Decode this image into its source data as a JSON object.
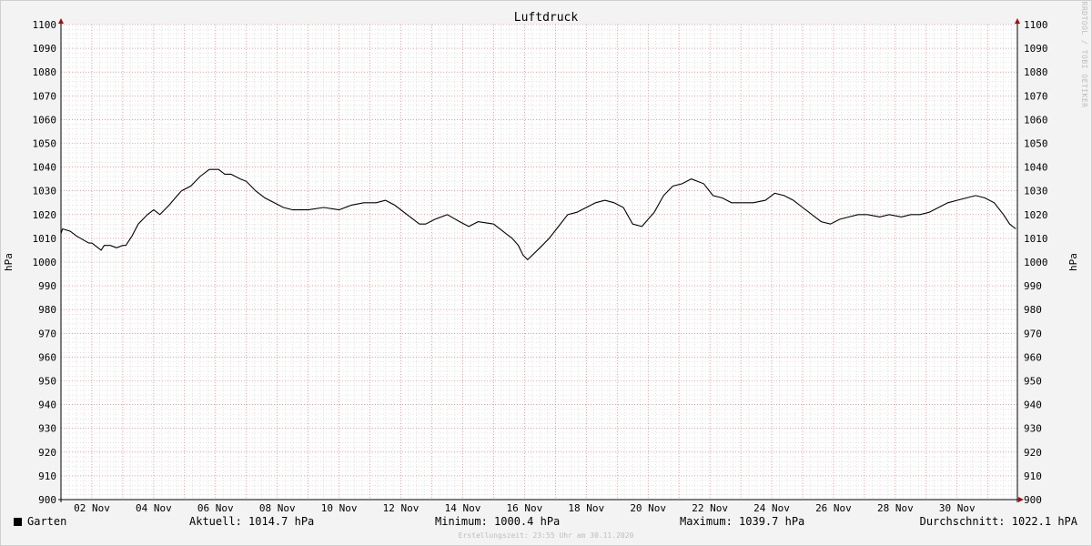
{
  "watermark": "RRDTOOL / TOBI OETIKER",
  "legend": {
    "series_name": "Garten",
    "series_color": "#000000",
    "current": "Aktuell: 1014.7 hPa",
    "minimum": "Minimum: 1000.4 hPa",
    "maximum": "Maximum: 1039.7 hPa",
    "average": "Durchschnitt: 1022.1 hPA"
  },
  "footer": {
    "created": "Erstellungszeit: 23:55 Uhr am 30.11.2020"
  },
  "colors": {
    "background": "#f3f3f3",
    "plot_bg": "#ffffff",
    "major_grid": "#e06060",
    "minor_grid": "#c8c8c8",
    "line": "#000000",
    "arrow": "#a01010"
  },
  "chart_data": {
    "type": "line",
    "title": "Luftdruck",
    "ylabel_left": "hPa",
    "ylabel_right": "hPa",
    "ylim": [
      900,
      1100
    ],
    "xlim": [
      0.0,
      30.95
    ],
    "x_unit": "days since start of November 2020",
    "yticks": [
      900,
      910,
      920,
      930,
      940,
      950,
      960,
      970,
      980,
      990,
      1000,
      1010,
      1020,
      1030,
      1040,
      1050,
      1060,
      1070,
      1080,
      1090,
      1100
    ],
    "xtick_values": [
      1,
      3,
      5,
      7,
      9,
      11,
      13,
      15,
      17,
      19,
      21,
      23,
      25,
      27,
      29
    ],
    "xtick_labels": [
      "02 Nov",
      "04 Nov",
      "06 Nov",
      "08 Nov",
      "10 Nov",
      "12 Nov",
      "14 Nov",
      "16 Nov",
      "18 Nov",
      "20 Nov",
      "22 Nov",
      "24 Nov",
      "26 Nov",
      "28 Nov",
      "30 Nov"
    ],
    "grid": true,
    "series": [
      {
        "name": "Garten",
        "x": [
          0.0,
          0.05,
          0.3,
          0.5,
          0.9,
          1.0,
          1.3,
          1.4,
          1.6,
          1.8,
          2.0,
          2.1,
          2.3,
          2.5,
          2.8,
          3.0,
          3.2,
          3.5,
          3.7,
          3.9,
          4.2,
          4.5,
          4.8,
          5.1,
          5.3,
          5.5,
          5.8,
          6.0,
          6.3,
          6.6,
          6.9,
          7.2,
          7.5,
          7.8,
          8.0,
          8.5,
          9.0,
          9.4,
          9.8,
          10.2,
          10.5,
          10.8,
          11.2,
          11.6,
          11.8,
          12.1,
          12.5,
          12.9,
          13.2,
          13.5,
          14.0,
          14.3,
          14.6,
          14.8,
          14.95,
          15.1,
          15.5,
          15.8,
          16.1,
          16.4,
          16.7,
          17.0,
          17.3,
          17.6,
          17.9,
          18.2,
          18.5,
          18.8,
          19.0,
          19.2,
          19.5,
          19.8,
          20.1,
          20.4,
          20.8,
          21.1,
          21.4,
          21.7,
          22.0,
          22.4,
          22.8,
          23.1,
          23.4,
          23.7,
          24.0,
          24.3,
          24.6,
          24.9,
          25.2,
          25.5,
          25.8,
          26.1,
          26.5,
          26.8,
          27.2,
          27.5,
          27.8,
          28.1,
          28.4,
          28.7,
          29.0,
          29.3,
          29.6,
          29.9,
          30.2,
          30.5,
          30.7,
          30.9
        ],
        "y": [
          1012,
          1014,
          1013,
          1011,
          1008,
          1008,
          1005,
          1007,
          1007,
          1006,
          1007,
          1007,
          1011,
          1016,
          1020,
          1022,
          1020,
          1024,
          1027,
          1030,
          1032,
          1036,
          1039,
          1039,
          1037,
          1037,
          1035,
          1034,
          1030,
          1027,
          1025,
          1023,
          1022,
          1022,
          1022,
          1023,
          1022,
          1024,
          1025,
          1025,
          1026,
          1024,
          1020,
          1016,
          1016,
          1018,
          1020,
          1017,
          1015,
          1017,
          1016,
          1013,
          1010,
          1007,
          1003,
          1001,
          1006,
          1010,
          1015,
          1020,
          1021,
          1023,
          1025,
          1026,
          1025,
          1023,
          1016,
          1015,
          1018,
          1021,
          1028,
          1032,
          1033,
          1035,
          1033,
          1028,
          1027,
          1025,
          1025,
          1025,
          1026,
          1029,
          1028,
          1026,
          1023,
          1020,
          1017,
          1016,
          1018,
          1019,
          1020,
          1020,
          1019,
          1020,
          1019,
          1020,
          1020,
          1021,
          1023,
          1025,
          1026,
          1027,
          1028,
          1027,
          1025,
          1020,
          1016,
          1014
        ]
      }
    ]
  }
}
